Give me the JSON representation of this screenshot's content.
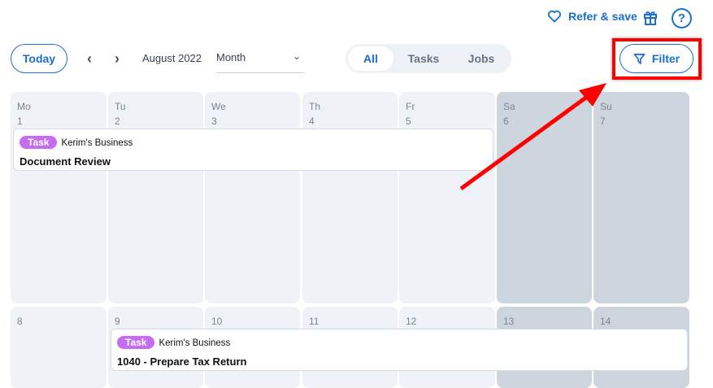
{
  "header": {
    "refer_label": "Refer & save",
    "help_label": "?"
  },
  "toolbar": {
    "today_label": "Today",
    "prev": "‹",
    "next": "›",
    "month_label": "August 2022",
    "view": "Month",
    "filter_label": "Filter",
    "segments": [
      {
        "label": "All",
        "active": true
      },
      {
        "label": "Tasks",
        "active": false
      },
      {
        "label": "Jobs",
        "active": false
      }
    ]
  },
  "calendar": {
    "weekdays": [
      "Mo",
      "Tu",
      "We",
      "Th",
      "Fr",
      "Sa",
      "Su"
    ],
    "week1": [
      "1",
      "2",
      "3",
      "4",
      "5",
      "6",
      "7"
    ],
    "week2": [
      "8",
      "9",
      "10",
      "11",
      "12",
      "13",
      "14"
    ],
    "events": [
      {
        "badge": "Task",
        "business": "Kerim's Business",
        "title": "Document Review"
      },
      {
        "badge": "Task",
        "business": "Kerim's Business",
        "title": "1040 - Prepare Tax Return"
      }
    ]
  },
  "colors": {
    "accent": "#1a6fcf",
    "task_badge": "#c66cf0",
    "annotation": "#ff0000"
  }
}
